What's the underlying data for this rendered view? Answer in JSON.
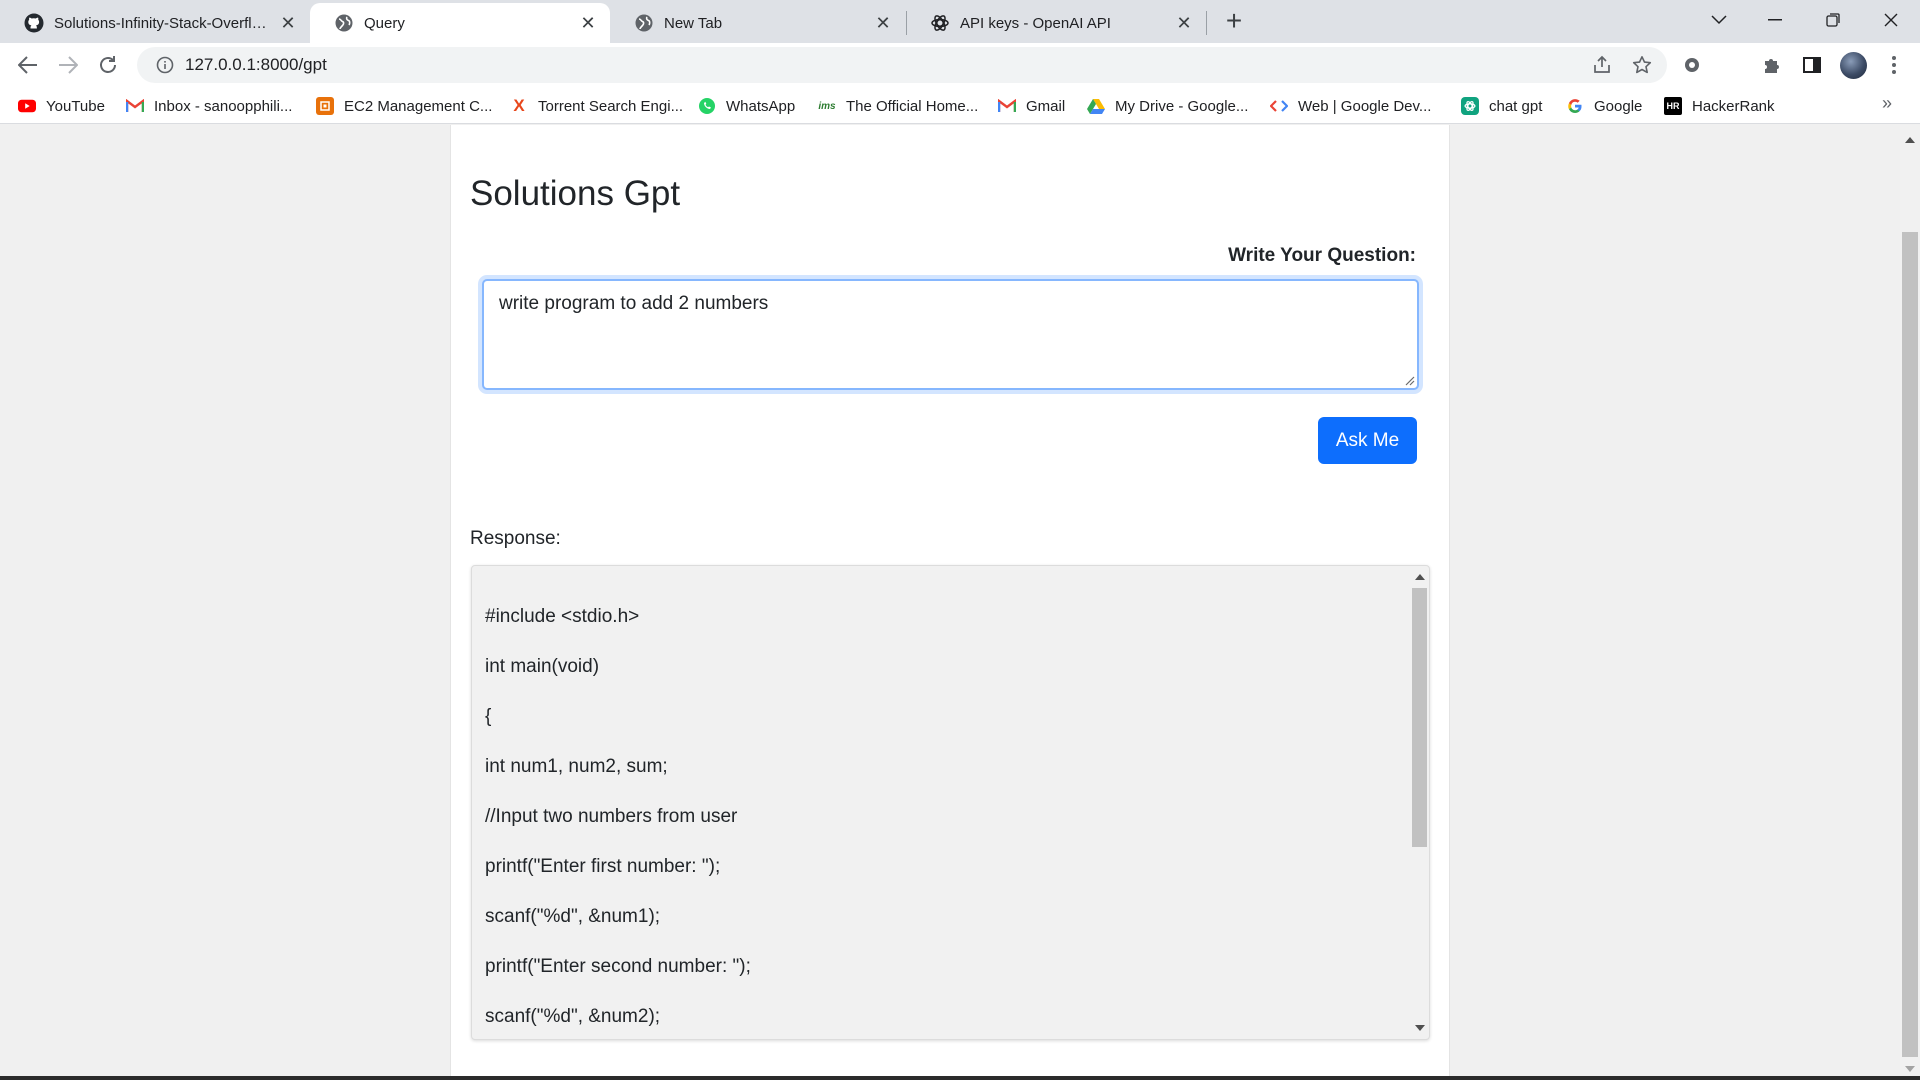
{
  "browser": {
    "tabs": [
      {
        "title": "Solutions-Infinity-Stack-Overflow",
        "icon": "github-icon",
        "active": false
      },
      {
        "title": "Query",
        "icon": "globe-icon",
        "active": true
      },
      {
        "title": "New Tab",
        "icon": "globe-icon",
        "active": false
      },
      {
        "title": "API keys - OpenAI API",
        "icon": "openai-icon",
        "active": false
      }
    ],
    "address": "127.0.0.1:8000/gpt",
    "bookmarks": [
      {
        "label": "YouTube",
        "icon": "youtube-icon",
        "color": "#ff0000"
      },
      {
        "label": "Inbox - sanoopphili...",
        "icon": "gmail-icon",
        "color": "#ea4335"
      },
      {
        "label": "EC2 Management C...",
        "icon": "aws-icon",
        "color": "#e8710a"
      },
      {
        "label": "Torrent Search Engi...",
        "icon": "torrent-icon",
        "color": "#e8471c"
      },
      {
        "label": "WhatsApp",
        "icon": "whatsapp-icon",
        "color": "#25d366"
      },
      {
        "label": "The Official Home...",
        "icon": "ims-icon",
        "color": "#2e7d32"
      },
      {
        "label": "Gmail",
        "icon": "gmail-icon",
        "color": "#ea4335"
      },
      {
        "label": "My Drive - Google...",
        "icon": "drive-icon",
        "color": "#1a73e8"
      },
      {
        "label": "Web  |  Google Dev...",
        "icon": "google-dev-icon",
        "color": "#4285f4"
      },
      {
        "label": "chat gpt",
        "icon": "chatgpt-icon",
        "color": "#10a37f"
      },
      {
        "label": "Google",
        "icon": "google-icon",
        "color": "#4285f4"
      },
      {
        "label": "HackerRank",
        "icon": "hackerrank-icon",
        "color": "#000000"
      }
    ]
  },
  "page": {
    "heading": "Solutions Gpt",
    "question_label": "Write Your Question:",
    "question_value": "write program to add 2 numbers",
    "ask_button": "Ask Me",
    "response_label": "Response:",
    "response_lines": [
      "#include <stdio.h>",
      "int main(void)",
      "{",
      "int num1, num2, sum;",
      "//Input two numbers from user",
      "printf(\"Enter first number: \");",
      "scanf(\"%d\", &num1);",
      "printf(\"Enter second number: \");",
      "scanf(\"%d\", &num2);"
    ]
  },
  "colors": {
    "accent": "#0d6efd",
    "focus_border": "#86b7fe"
  }
}
